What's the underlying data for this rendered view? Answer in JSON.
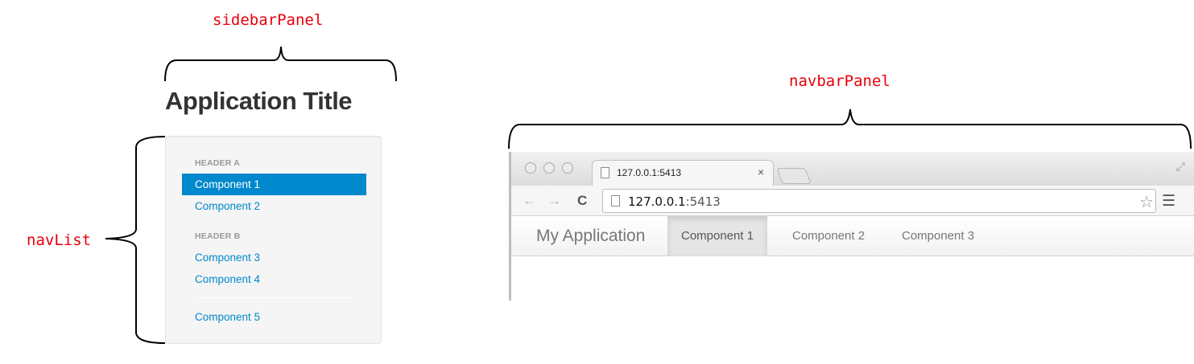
{
  "annotations": {
    "sidebar_panel": "sidebarPanel",
    "nav_list": "navList",
    "navbar_panel": "navbarPanel"
  },
  "sidebar": {
    "title": "Application Title",
    "nav": [
      {
        "type": "header",
        "label": "HEADER A"
      },
      {
        "type": "item",
        "label": "Component 1",
        "active": true
      },
      {
        "type": "item",
        "label": "Component 2"
      },
      {
        "type": "header",
        "label": "HEADER B"
      },
      {
        "type": "item",
        "label": "Component 3"
      },
      {
        "type": "item",
        "label": "Component 4"
      },
      {
        "type": "divider"
      },
      {
        "type": "item",
        "label": "Component 5"
      }
    ]
  },
  "browser": {
    "tab_title": "127.0.0.1:5413",
    "tab_close": "×",
    "url_host": "127.0.0.1",
    "url_port": ":5413",
    "icons": {
      "back": "back-arrow-icon",
      "forward": "forward-arrow-icon",
      "reload": "reload-icon",
      "star": "star-icon",
      "menu": "hamburger-menu-icon"
    }
  },
  "navbar": {
    "brand": "My Application",
    "items": [
      {
        "label": "Component 1",
        "active": true
      },
      {
        "label": "Component 2"
      },
      {
        "label": "Component 3"
      }
    ]
  },
  "colors": {
    "annotation": "#e8000b",
    "accent": "#0088cc"
  }
}
